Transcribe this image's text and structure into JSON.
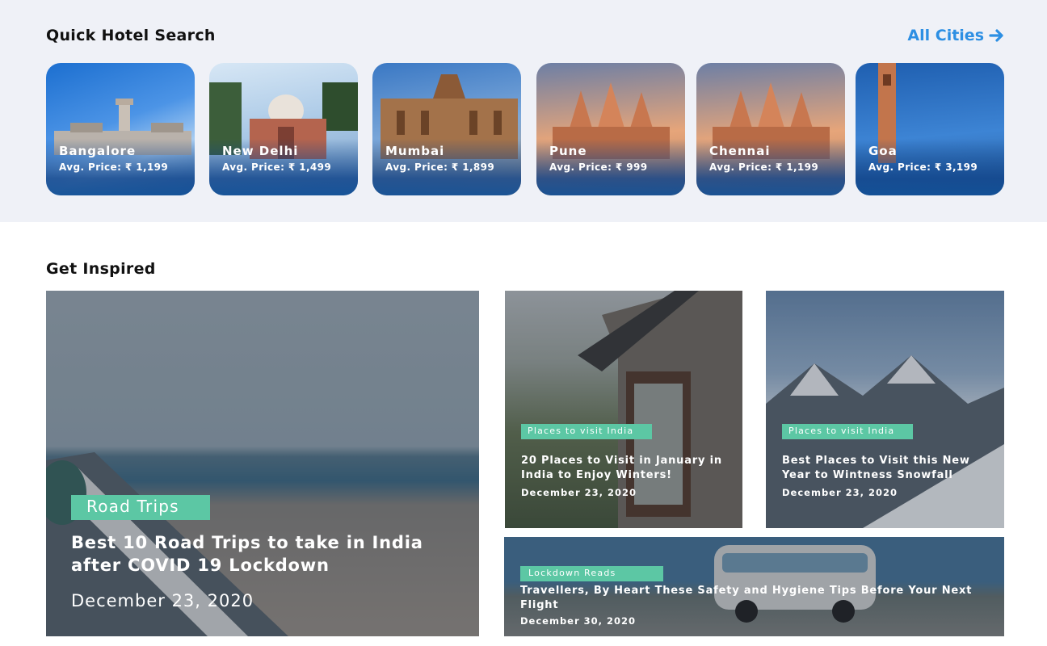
{
  "quick_search": {
    "title": "Quick Hotel Search",
    "all_cities_label": "All Cities",
    "cities": [
      {
        "name": "Bangalore",
        "price": "Avg. Price:  ₹ 1,199"
      },
      {
        "name": "New Delhi",
        "price": "Avg. Price:  ₹ 1,499"
      },
      {
        "name": "Mumbai",
        "price": "Avg. Price:  ₹ 1,899"
      },
      {
        "name": "Pune",
        "price": "Avg. Price:  ₹ 999"
      },
      {
        "name": "Chennai",
        "price": "Avg. Price:  ₹ 1,199"
      },
      {
        "name": "Goa",
        "price": "Avg. Price:  ₹ 3,199"
      }
    ]
  },
  "inspired": {
    "title": "Get Inspired",
    "featured": {
      "tag": "Road Trips",
      "title": "Best 10 Road Trips to take in India after COVID 19 Lockdown",
      "date": "December 23, 2020"
    },
    "articles": [
      {
        "tag": "Places to visit India",
        "title": "20 Places to Visit in January in India to Enjoy Winters!",
        "date": "December 23, 2020"
      },
      {
        "tag": "Places to visit India",
        "title": "Best Places to Visit this New Year to  Wintness Snowfall",
        "date": "December 23, 2020"
      },
      {
        "tag": "Lockdown Reads",
        "title": "Travellers, By Heart These Safety and Hygiene Tips Before Your Next Flight",
        "date": "December 30, 2020"
      }
    ]
  },
  "colors": {
    "accent": "#2d8fe3",
    "tag": "#5cc7a4",
    "band": "#eff1f7"
  }
}
